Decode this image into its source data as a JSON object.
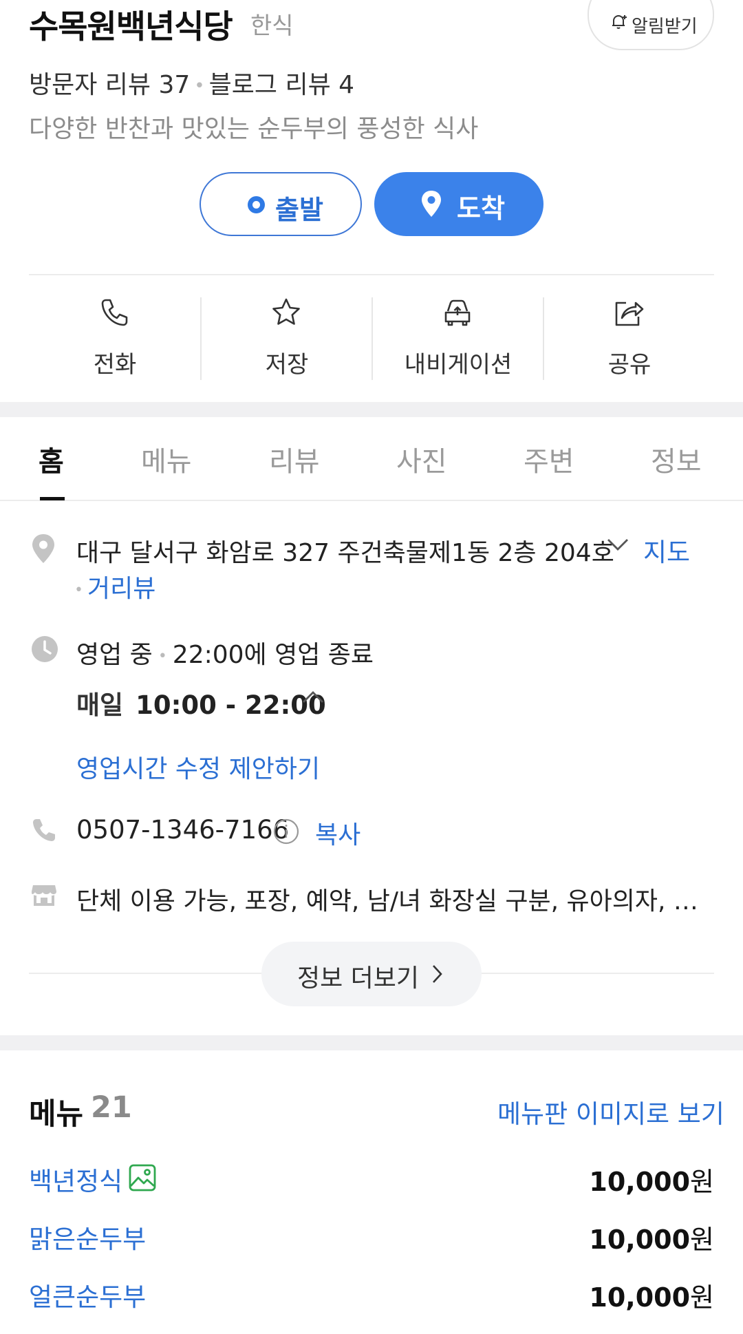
{
  "place": {
    "name": "수목원백년식당",
    "category": "한식",
    "visitor_reviews": "방문자 리뷰 37",
    "blog_reviews": "블로그 리뷰 4",
    "description": "다양한 반찬과 맛있는 순두부의 풍성한 식사"
  },
  "notify": {
    "label": "알림받기"
  },
  "route": {
    "depart_label": "출발",
    "arrive_label": "도착"
  },
  "actions": [
    {
      "label": "전화",
      "icon": "phone-icon"
    },
    {
      "label": "저장",
      "icon": "star-icon"
    },
    {
      "label": "내비게이션",
      "icon": "car-icon"
    },
    {
      "label": "공유",
      "icon": "share-icon"
    }
  ],
  "tabs": [
    "홈",
    "메뉴",
    "리뷰",
    "사진",
    "주변",
    "정보"
  ],
  "active_tab": "홈",
  "info": {
    "address": "대구 달서구 화암로 327 주건축물제1동 2층 204호",
    "map_link": "지도",
    "street_view": "거리뷰",
    "status": "영업 중",
    "closing": "22:00에 영업 종료",
    "hours_day": "매일",
    "hours_time": "10:00 - 22:00",
    "suggest_edit": "영업시간 수정 제안하기",
    "phone": "0507-1346-7166",
    "copy": "복사",
    "amenities": "단체 이용 가능, 포장, 예약, 남/녀 화장실 구분, 유아의자, 무선 인터넷",
    "more_label": "정보 더보기"
  },
  "menu": {
    "title": "메뉴",
    "count": "21",
    "image_link": "메뉴판 이미지로 보기",
    "items": [
      {
        "name": "백년정식",
        "price": "10,000",
        "unit": "원",
        "has_photo_icon": true
      },
      {
        "name": "맑은순두부",
        "price": "10,000",
        "unit": "원"
      },
      {
        "name": "얼큰순두부",
        "price": "10,000",
        "unit": "원"
      }
    ]
  },
  "colors": {
    "accent_blue": "#3b82ea",
    "link_blue": "#2b6fd3",
    "photo_icon_green": "#2fa84f",
    "section_gap": "#f0f0f2"
  }
}
